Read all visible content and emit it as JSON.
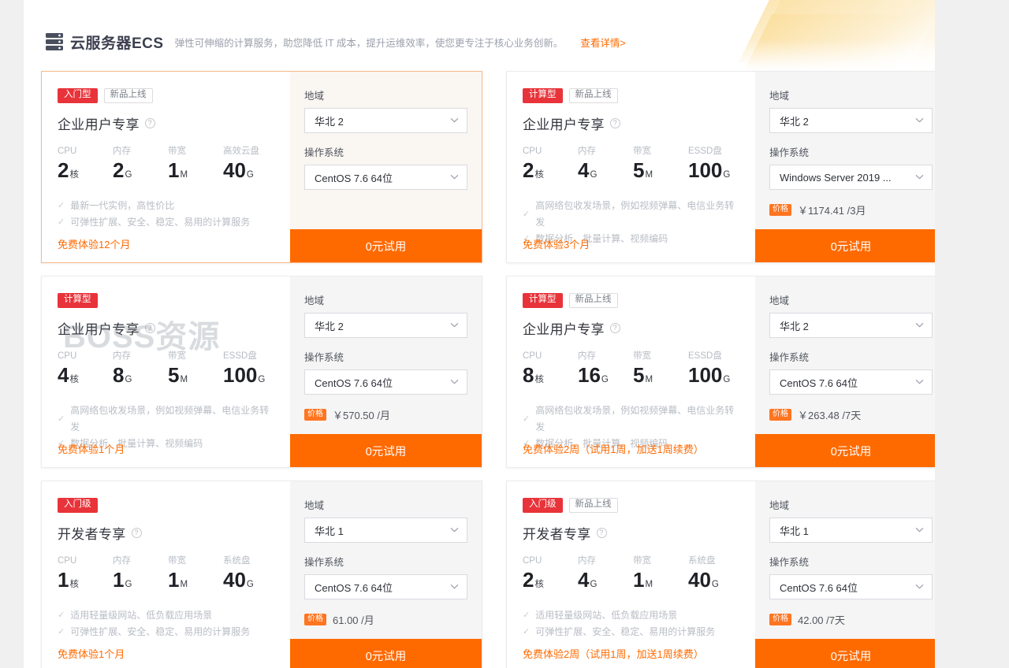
{
  "header": {
    "icon": "server-stack-icon",
    "title": "云服务器ECS",
    "description": "弹性可伸缩的计算服务，助您降低 IT 成本，提升运维效率，使您更专注于核心业务创新。",
    "link_label": "查看详情>"
  },
  "watermark": "BOSS资源",
  "labels": {
    "region": "地域",
    "os": "操作系统",
    "cpu": "CPU",
    "memory": "内存",
    "bandwidth": "带宽",
    "price_badge": "价格",
    "cta": "0元试用",
    "check": "✓",
    "question": "?"
  },
  "colors": {
    "accent": "#ff6a00",
    "tag_red": "#e8333a",
    "price_badge": "#ff7520",
    "highlight_border": "#f5b98a",
    "panel_bg": "#f5f5f5",
    "panel_bg_highlight": "#faf6f2"
  },
  "cards": [
    {
      "highlighted": true,
      "tag_type": "入门型",
      "tag_new": "新品上线",
      "title": "企业用户专享",
      "specs": [
        {
          "label": "CPU",
          "value": "2",
          "unit": "核"
        },
        {
          "label": "内存",
          "value": "2",
          "unit": "G"
        },
        {
          "label": "带宽",
          "value": "1",
          "unit": "M"
        },
        {
          "label": "高效云盘",
          "value": "40",
          "unit": "G"
        }
      ],
      "features": [
        "最新一代实例，高性价比",
        "可弹性扩展、安全、稳定、易用的计算服务"
      ],
      "free_note": "免费体验12个月",
      "region_label": "地域",
      "region_value": "华北 2",
      "os_label": "操作系统",
      "os_value": "CentOS 7.6 64位",
      "price": "",
      "cta": "0元试用"
    },
    {
      "highlighted": false,
      "tag_type": "计算型",
      "tag_new": "新品上线",
      "title": "企业用户专享",
      "specs": [
        {
          "label": "CPU",
          "value": "2",
          "unit": "核"
        },
        {
          "label": "内存",
          "value": "4",
          "unit": "G"
        },
        {
          "label": "带宽",
          "value": "5",
          "unit": "M"
        },
        {
          "label": "ESSD盘",
          "value": "100",
          "unit": "G"
        }
      ],
      "features": [
        "高网络包收发场景，例如视频弹幕、电信业务转发",
        "数据分析、批量计算、视频编码"
      ],
      "free_note": "免费体验3个月",
      "region_label": "地域",
      "region_value": "华北 2",
      "os_label": "操作系统",
      "os_value": "Windows Server 2019 ...",
      "price": "￥1174.41 /3月",
      "cta": "0元试用"
    },
    {
      "highlighted": false,
      "tag_type": "计算型",
      "tag_new": "",
      "title": "企业用户专享",
      "specs": [
        {
          "label": "CPU",
          "value": "4",
          "unit": "核"
        },
        {
          "label": "内存",
          "value": "8",
          "unit": "G"
        },
        {
          "label": "带宽",
          "value": "5",
          "unit": "M"
        },
        {
          "label": "ESSD盘",
          "value": "100",
          "unit": "G"
        }
      ],
      "features": [
        "高网络包收发场景，例如视频弹幕、电信业务转发",
        "数据分析、批量计算、视频编码"
      ],
      "free_note": "免费体验1个月",
      "region_label": "地域",
      "region_value": "华北 2",
      "os_label": "操作系统",
      "os_value": "CentOS 7.6 64位",
      "price": "￥570.50 /月",
      "cta": "0元试用"
    },
    {
      "highlighted": false,
      "tag_type": "计算型",
      "tag_new": "新品上线",
      "title": "企业用户专享",
      "specs": [
        {
          "label": "CPU",
          "value": "8",
          "unit": "核"
        },
        {
          "label": "内存",
          "value": "16",
          "unit": "G"
        },
        {
          "label": "带宽",
          "value": "5",
          "unit": "M"
        },
        {
          "label": "ESSD盘",
          "value": "100",
          "unit": "G"
        }
      ],
      "features": [
        "高网络包收发场景，例如视频弹幕、电信业务转发",
        "数据分析、批量计算、视频编码"
      ],
      "free_note": "免费体验2周（试用1周，加送1周续费）",
      "region_label": "地域",
      "region_value": "华北 2",
      "os_label": "操作系统",
      "os_value": "CentOS 7.6 64位",
      "price": "￥263.48 /7天",
      "cta": "0元试用"
    },
    {
      "highlighted": false,
      "tag_type": "入门级",
      "tag_new": "",
      "title": "开发者专享",
      "specs": [
        {
          "label": "CPU",
          "value": "1",
          "unit": "核"
        },
        {
          "label": "内存",
          "value": "1",
          "unit": "G"
        },
        {
          "label": "带宽",
          "value": "1",
          "unit": "M"
        },
        {
          "label": "系统盘",
          "value": "40",
          "unit": "G"
        }
      ],
      "features": [
        "适用轻量级网站、低负载应用场景",
        "可弹性扩展、安全、稳定、易用的计算服务"
      ],
      "free_note": "免费体验1个月",
      "region_label": "地域",
      "region_value": "华北 1",
      "os_label": "操作系统",
      "os_value": "CentOS 7.6 64位",
      "price": "61.00 /月",
      "cta": "0元试用"
    },
    {
      "highlighted": false,
      "tag_type": "入门级",
      "tag_new": "新品上线",
      "title": "开发者专享",
      "specs": [
        {
          "label": "CPU",
          "value": "2",
          "unit": "核"
        },
        {
          "label": "内存",
          "value": "4",
          "unit": "G"
        },
        {
          "label": "带宽",
          "value": "1",
          "unit": "M"
        },
        {
          "label": "系统盘",
          "value": "40",
          "unit": "G"
        }
      ],
      "features": [
        "适用轻量级网站、低负载应用场景",
        "可弹性扩展、安全、稳定、易用的计算服务"
      ],
      "free_note": "免费体验2周（试用1周，加送1周续费）",
      "region_label": "地域",
      "region_value": "华北 1",
      "os_label": "操作系统",
      "os_value": "CentOS 7.6 64位",
      "price": "42.00 /7天",
      "cta": "0元试用"
    }
  ]
}
